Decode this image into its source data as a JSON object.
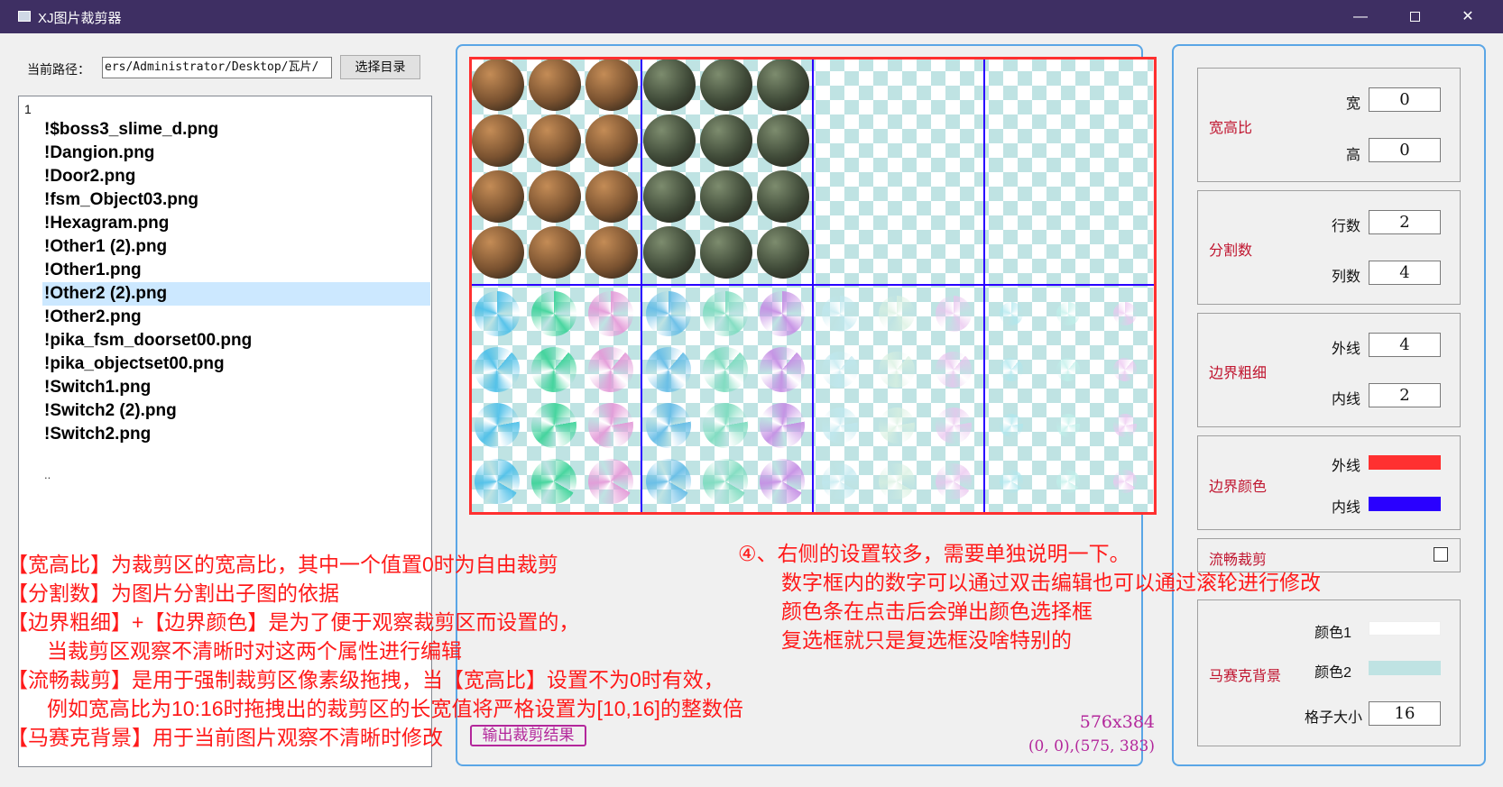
{
  "window": {
    "title": "XJ图片裁剪器"
  },
  "path": {
    "label": "当前路径：",
    "value": "ers/Administrator/Desktop/瓦片/",
    "browse_label": "选择目录"
  },
  "file_list": {
    "header": "1",
    "items": [
      "!$boss3_slime_d.png",
      "!Dangion.png",
      "!Door2.png",
      "!fsm_Object03.png",
      "!Hexagram.png",
      "!Other1 (2).png",
      "!Other1.png",
      "!Other2 (2).png",
      "!Other2.png",
      "!pika_fsm_doorset00.png",
      "!pika_objectset00.png",
      "!Switch1.png",
      "!Switch2 (2).png",
      "!Switch2.png"
    ],
    "selected_index": 7,
    "more": ".."
  },
  "preview": {
    "size_text": "576x384",
    "coords_text": "(0, 0),(575, 383)",
    "output_label": "输出裁剪结果"
  },
  "settings": {
    "aspect": {
      "title": "宽高比",
      "width_label": "宽",
      "width_value": "0",
      "height_label": "高",
      "height_value": "0"
    },
    "split": {
      "title": "分割数",
      "rows_label": "行数",
      "rows_value": "2",
      "cols_label": "列数",
      "cols_value": "4"
    },
    "border_width": {
      "title": "边界粗细",
      "outer_label": "外线",
      "outer_value": "4",
      "inner_label": "内线",
      "inner_value": "2"
    },
    "border_color": {
      "title": "边界颜色",
      "outer_label": "外线",
      "outer_color": "#ff3030",
      "inner_label": "内线",
      "inner_color": "#2a00ff"
    },
    "smooth": {
      "title": "流畅裁剪",
      "checked": false
    },
    "mosaic": {
      "title": "马赛克背景",
      "color1_label": "颜色1",
      "color1": "#ffffff",
      "color2_label": "颜色2",
      "color2": "#bfe3e3",
      "grid_label": "格子大小",
      "grid_value": "16"
    }
  },
  "annotations": {
    "left": [
      "【宽高比】为裁剪区的宽高比，其中一个值置0时为自由裁剪",
      "【分割数】为图片分割出子图的依据",
      "【边界粗细】+【边界颜色】是为了便于观察裁剪区而设置的，",
      "当裁剪区观察不清晰时对这两个属性进行编辑",
      "【流畅裁剪】是用于强制裁剪区像素级拖拽，当【宽高比】设置不为0时有效，",
      "例如宽高比为10:16时拖拽出的裁剪区的长宽值将严格设置为[10,16]的整数倍",
      "【马赛克背景】用于当前图片观察不清晰时修改"
    ],
    "right": [
      "④、右侧的设置较多，需要单独说明一下。",
      "数字框内的数字可以通过双击编辑也可以通过滚轮进行修改",
      "颜色条在点击后会弹出颜色选择框",
      "复选框就只是复选框没啥特别的"
    ]
  }
}
